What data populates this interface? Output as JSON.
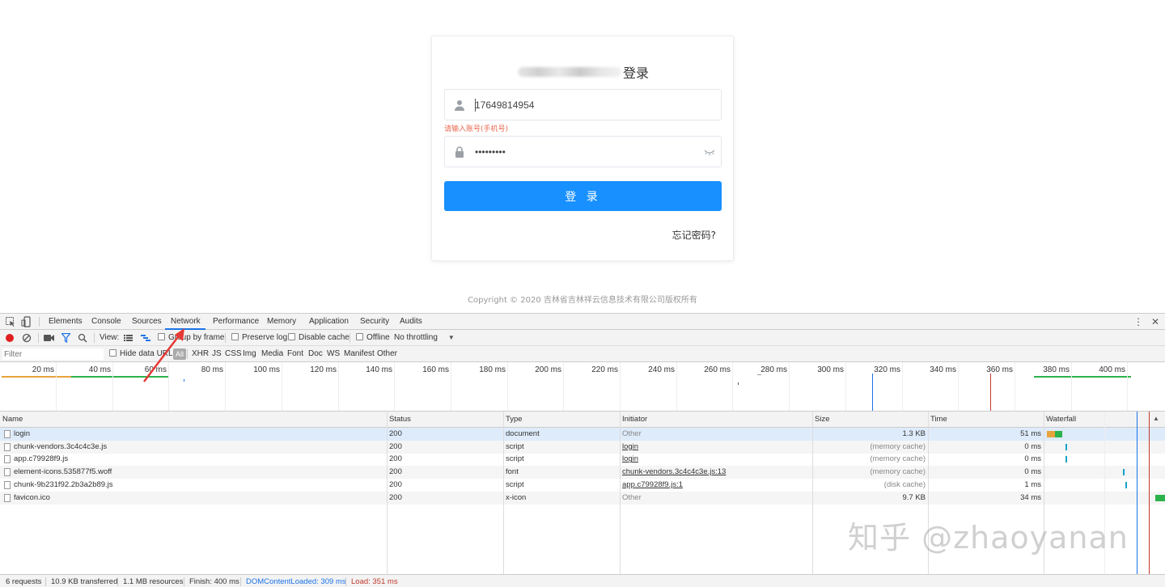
{
  "login": {
    "title": "登录",
    "account_value": "17649814954",
    "account_error": "请输入账号(手机号)",
    "password_value": "•••••••••",
    "submit_label": "登 录",
    "forgot_label": "忘记密码?",
    "copyright": "Copyright © 2020 吉林省吉林祥云信息技术有限公司版权所有"
  },
  "devtools": {
    "tabs": [
      "Elements",
      "Console",
      "Sources",
      "Network",
      "Performance",
      "Memory",
      "Application",
      "Security",
      "Audits"
    ],
    "active_tab": "Network",
    "toolbar": {
      "view_label": "View:",
      "group_by_frame": "Group by frame",
      "preserve_log": "Preserve log",
      "disable_cache": "Disable cache",
      "offline": "Offline",
      "throttling": "No throttling"
    },
    "filter": {
      "placeholder": "Filter",
      "hide_data_urls": "Hide data URLs",
      "types": [
        "All",
        "XHR",
        "JS",
        "CSS",
        "Img",
        "Media",
        "Font",
        "Doc",
        "WS",
        "Manifest",
        "Other"
      ]
    },
    "overview_ticks": [
      "20 ms",
      "40 ms",
      "60 ms",
      "80 ms",
      "100 ms",
      "120 ms",
      "140 ms",
      "160 ms",
      "180 ms",
      "200 ms",
      "220 ms",
      "240 ms",
      "260 ms",
      "280 ms",
      "300 ms",
      "320 ms",
      "340 ms",
      "360 ms",
      "380 ms",
      "400 ms",
      "4"
    ],
    "columns": [
      "Name",
      "Status",
      "Type",
      "Initiator",
      "Size",
      "Time",
      "Waterfall"
    ],
    "requests": [
      {
        "name": "login",
        "status": "200",
        "type": "document",
        "initiator": "Other",
        "size": "1.3 KB",
        "time": "51 ms"
      },
      {
        "name": "chunk-vendors.3c4c4c3e.js",
        "status": "200",
        "type": "script",
        "initiator": "login",
        "size": "(memory cache)",
        "time": "0 ms"
      },
      {
        "name": "app.c79928f9.js",
        "status": "200",
        "type": "script",
        "initiator": "login",
        "size": "(memory cache)",
        "time": "0 ms"
      },
      {
        "name": "element-icons.535877f5.woff",
        "status": "200",
        "type": "font",
        "initiator": "chunk-vendors.3c4c4c3e.js:13",
        "size": "(memory cache)",
        "time": "0 ms"
      },
      {
        "name": "chunk-9b231f92.2b3a2b89.js",
        "status": "200",
        "type": "script",
        "initiator": "app.c79928f9.js:1",
        "size": "(disk cache)",
        "time": "1 ms"
      },
      {
        "name": "favicon.ico",
        "status": "200",
        "type": "x-icon",
        "initiator": "Other",
        "size": "9.7 KB",
        "time": "34 ms"
      }
    ],
    "status_bar": {
      "requests": "6 requests",
      "transferred": "10.9 KB transferred",
      "resources": "1.1 MB resources",
      "finish": "Finish: 400 ms",
      "dom_loaded": "DOMContentLoaded: 309 ms",
      "load": "Load: 351 ms"
    }
  },
  "watermark": "知乎 @zhaoyanan",
  "colors": {
    "primary_button": "#1890ff",
    "error": "#e9694f",
    "active_tab_underline": "#1a73e8",
    "dom_loaded_line": "#1a73e8",
    "load_line": "#c0392b"
  }
}
